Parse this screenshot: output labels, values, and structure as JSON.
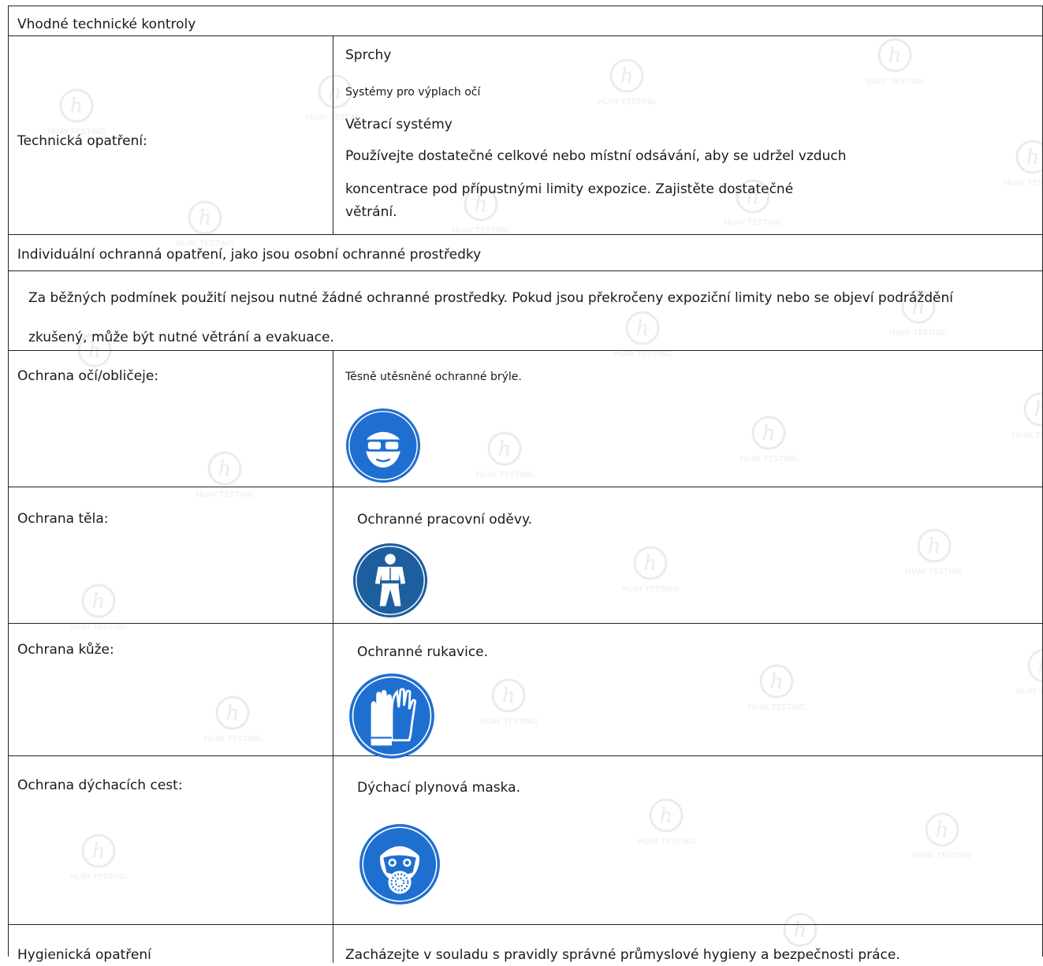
{
  "header": {
    "title": "Vhodné technické kontroly"
  },
  "technical": {
    "label": "Technická opatření:",
    "items": {
      "showers": "Sprchy",
      "eyewash": "Systémy pro výplach očí",
      "ventilation": "Větrací systémy",
      "exhaust_line1": "Používejte dostatečné celkové nebo místní odsávání, aby se udržel vzduch",
      "exhaust_line2": "koncentrace pod přípustnými limity expozice. Zajistěte dostatečné",
      "exhaust_line3": "větrání."
    }
  },
  "personal": {
    "title": "Individuální ochranná opatření, jako jsou osobní ochranné prostředky",
    "note_line1": "Za běžných podmínek použití nejsou nutné žádné ochranné prostředky. Pokud jsou překročeny expoziční limity nebo se objeví podráždění",
    "note_line2": "zkušený, může být nutné větrání a evakuace."
  },
  "eye": {
    "label": "Ochrana očí/obličeje:",
    "value": "Těsně utěsněné ochranné brýle.",
    "icon": "goggles-sign-icon"
  },
  "body": {
    "label": "Ochrana těla:",
    "value": "Ochranné pracovní oděvy.",
    "icon": "protective-clothing-sign-icon"
  },
  "skin": {
    "label": "Ochrana kůže:",
    "value": "Ochranné rukavice.",
    "icon": "gloves-sign-icon"
  },
  "respiratory": {
    "label": "Ochrana dýchacích cest:",
    "value": "Dýchací plynová maska.",
    "icon": "gas-mask-sign-icon"
  },
  "hygiene": {
    "label": "Hygienická opatření",
    "value": "Zacházejte v souladu s pravidly správné průmyslové hygieny a bezpečnosti práce."
  },
  "colors": {
    "sign_blue": "#1f6fd1",
    "sign_blue_dark": "#1d5f9e",
    "border": "#222222",
    "watermark": "#c8c8c8"
  },
  "watermark": {
    "text": "HUAY TESTING",
    "letter": "h"
  }
}
